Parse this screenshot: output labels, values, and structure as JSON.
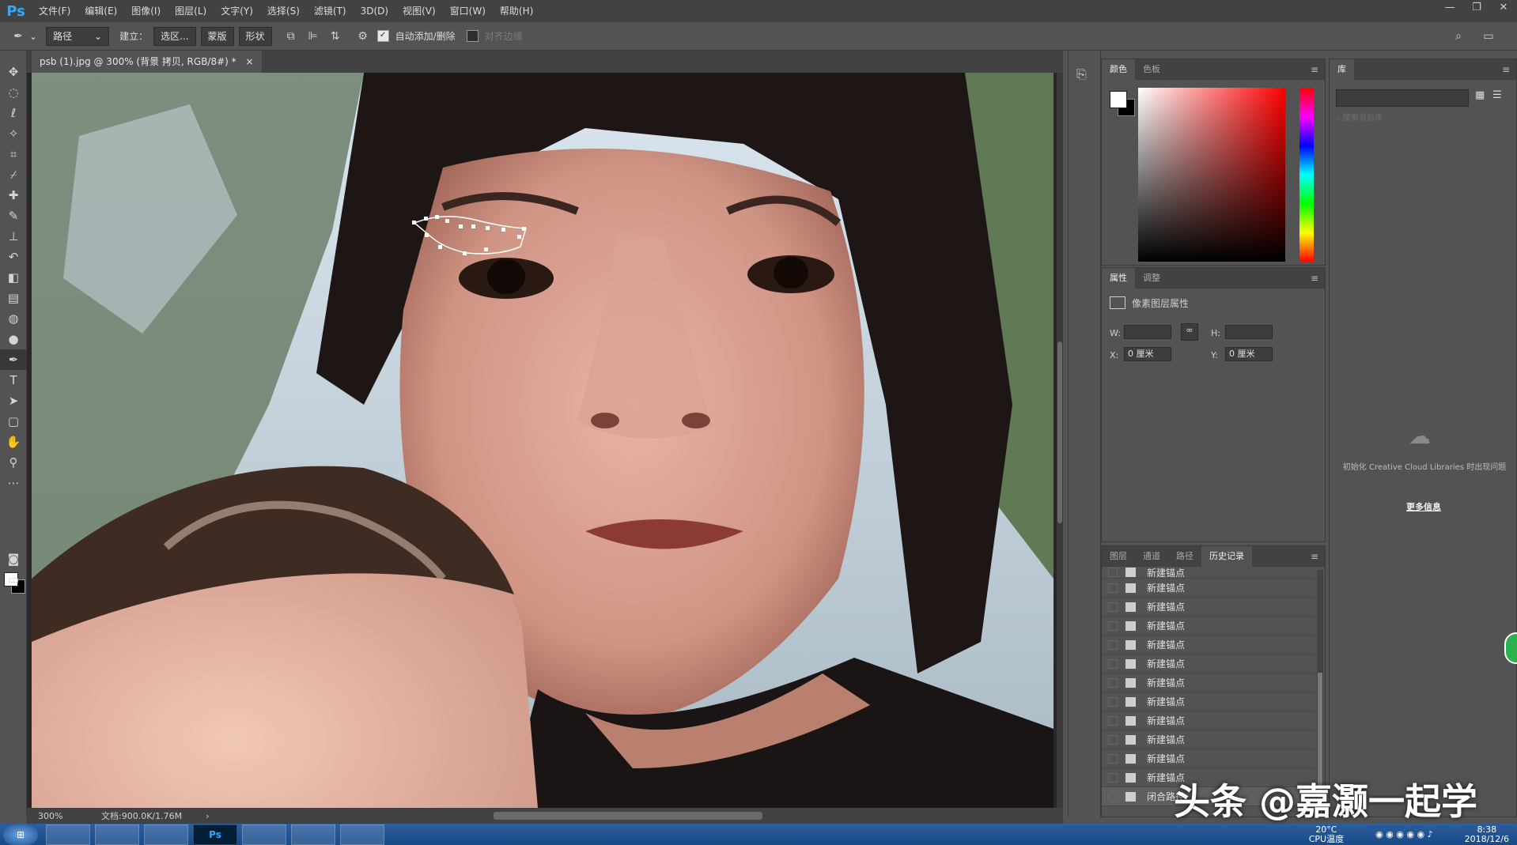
{
  "app": {
    "logo": "Ps"
  },
  "menu": [
    "文件(F)",
    "编辑(E)",
    "图像(I)",
    "图层(L)",
    "文字(Y)",
    "选择(S)",
    "滤镜(T)",
    "3D(D)",
    "视图(V)",
    "窗口(W)",
    "帮助(H)"
  ],
  "window_controls": {
    "minimize": "—",
    "restore": "❐",
    "close": "✕"
  },
  "options": {
    "mode": "路径",
    "build_label": "建立：",
    "selection_btn": "选区...",
    "mask_btn": "蒙版",
    "shape_btn": "形状",
    "auto_add_delete": "自动添加/删除",
    "align_edges": "对齐边缘"
  },
  "document": {
    "tab_title": "psb (1).jpg @ 300% (背景 拷贝, RGB/8#) *",
    "close": "×"
  },
  "status": {
    "zoom": "300%",
    "doc_size": "文档:900.0K/1.76M",
    "arrow": "›"
  },
  "color_panel": {
    "tabs": [
      "颜色",
      "色板"
    ],
    "menu": "≡"
  },
  "properties_panel": {
    "tabs": [
      "属性",
      "调整"
    ],
    "title": "像素图层属性",
    "w_label": "W:",
    "h_label": "H:",
    "x_label": "X:",
    "x_value": "0 厘米",
    "y_label": "Y:",
    "y_value": "0 厘米",
    "link": "∞"
  },
  "history_panel": {
    "tabs": [
      "图层",
      "通道",
      "路径",
      "历史记录"
    ],
    "items": [
      "新建锚点",
      "新建锚点",
      "新建锚点",
      "新建锚点",
      "新建锚点",
      "新建锚点",
      "新建锚点",
      "新建锚点",
      "新建锚点",
      "新建锚点",
      "新建锚点",
      "新建锚点",
      "闭合路径"
    ]
  },
  "library_panel": {
    "tab": "库",
    "search_placeholder": "搜索当前库",
    "message": "初始化 Creative Cloud Libraries 时出现问题",
    "more_info": "更多信息"
  },
  "taskbar": {
    "apps": [
      "",
      "",
      "",
      "Ps",
      "",
      "",
      ""
    ],
    "temp": "20°C",
    "cpu": "CPU温度",
    "time": "8:38",
    "date": "2018/12/6"
  },
  "watermark": "头条 @嘉灏一起学",
  "colors": {
    "accent": "#31a8ff",
    "panel_bg": "#535353",
    "bar_bg": "#424242"
  }
}
